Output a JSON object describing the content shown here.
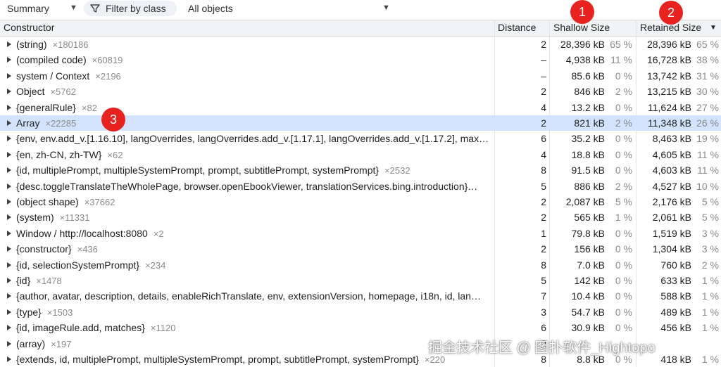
{
  "toolbar": {
    "view_label": "Summary",
    "filter_label": "Filter by class",
    "objects_label": "All objects"
  },
  "columns": {
    "constructor": "Constructor",
    "distance": "Distance",
    "shallow": "Shallow Size",
    "retained": "Retained Size"
  },
  "rows": [
    {
      "name": "(string)",
      "count": "×180186",
      "distance": "2",
      "shallow": "28,396 kB",
      "shallow_pct": "65 %",
      "retained": "28,396 kB",
      "retained_pct": "65 %"
    },
    {
      "name": "(compiled code)",
      "count": "×60819",
      "distance": "–",
      "shallow": "4,938 kB",
      "shallow_pct": "11 %",
      "retained": "16,728 kB",
      "retained_pct": "38 %"
    },
    {
      "name": "system / Context",
      "count": "×2196",
      "distance": "–",
      "shallow": "85.6 kB",
      "shallow_pct": "0 %",
      "retained": "13,742 kB",
      "retained_pct": "31 %"
    },
    {
      "name": "Object",
      "count": "×5762",
      "distance": "2",
      "shallow": "846 kB",
      "shallow_pct": "2 %",
      "retained": "13,215 kB",
      "retained_pct": "30 %"
    },
    {
      "name": "{generalRule}",
      "count": "×82",
      "distance": "4",
      "shallow": "13.2 kB",
      "shallow_pct": "0 %",
      "retained": "11,624 kB",
      "retained_pct": "27 %"
    },
    {
      "name": "Array",
      "count": "×22285",
      "distance": "2",
      "shallow": "821 kB",
      "shallow_pct": "2 %",
      "retained": "11,348 kB",
      "retained_pct": "26 %"
    },
    {
      "name": "{env, env.add_v.[1.16.10], langOverrides, langOverrides.add_v.[1.17.1], langOverrides.add_v.[1.17.2], max…",
      "count": "",
      "distance": "6",
      "shallow": "35.2 kB",
      "shallow_pct": "0 %",
      "retained": "8,463 kB",
      "retained_pct": "19 %"
    },
    {
      "name": "{en, zh-CN, zh-TW}",
      "count": "×62",
      "distance": "4",
      "shallow": "18.8 kB",
      "shallow_pct": "0 %",
      "retained": "4,605 kB",
      "retained_pct": "11 %"
    },
    {
      "name": "{id, multiplePrompt, multipleSystemPrompt, prompt, subtitlePrompt, systemPrompt}",
      "count": "×2532",
      "distance": "8",
      "shallow": "91.5 kB",
      "shallow_pct": "0 %",
      "retained": "4,603 kB",
      "retained_pct": "11 %"
    },
    {
      "name": "{desc.toggleTranslateTheWholePage, browser.openEbookViewer, translationServices.bing.introduction}…",
      "count": "",
      "distance": "5",
      "shallow": "886 kB",
      "shallow_pct": "2 %",
      "retained": "4,527 kB",
      "retained_pct": "10 %"
    },
    {
      "name": "(object shape)",
      "count": "×37662",
      "distance": "2",
      "shallow": "2,087 kB",
      "shallow_pct": "5 %",
      "retained": "2,176 kB",
      "retained_pct": "5 %"
    },
    {
      "name": "(system)",
      "count": "×11331",
      "distance": "2",
      "shallow": "565 kB",
      "shallow_pct": "1 %",
      "retained": "2,061 kB",
      "retained_pct": "5 %"
    },
    {
      "name": "Window / http://localhost:8080",
      "count": "×2",
      "distance": "1",
      "shallow": "79.8 kB",
      "shallow_pct": "0 %",
      "retained": "1,519 kB",
      "retained_pct": "3 %"
    },
    {
      "name": "{constructor}",
      "count": "×436",
      "distance": "2",
      "shallow": "156 kB",
      "shallow_pct": "0 %",
      "retained": "1,304 kB",
      "retained_pct": "3 %"
    },
    {
      "name": "{id, selectionSystemPrompt}",
      "count": "×234",
      "distance": "8",
      "shallow": "7.0 kB",
      "shallow_pct": "0 %",
      "retained": "760 kB",
      "retained_pct": "2 %"
    },
    {
      "name": "{id}",
      "count": "×1478",
      "distance": "5",
      "shallow": "142 kB",
      "shallow_pct": "0 %",
      "retained": "633 kB",
      "retained_pct": "1 %"
    },
    {
      "name": "{author, avatar, description, details, enableRichTranslate, env, extensionVersion, homepage, i18n, id, lan…",
      "count": "",
      "distance": "7",
      "shallow": "10.4 kB",
      "shallow_pct": "0 %",
      "retained": "588 kB",
      "retained_pct": "1 %"
    },
    {
      "name": "{type}",
      "count": "×1503",
      "distance": "3",
      "shallow": "54.7 kB",
      "shallow_pct": "0 %",
      "retained": "489 kB",
      "retained_pct": "1 %"
    },
    {
      "name": "{id, imageRule.add, matches}",
      "count": "×1120",
      "distance": "6",
      "shallow": "30.9 kB",
      "shallow_pct": "0 %",
      "retained": "456 kB",
      "retained_pct": "1 %"
    },
    {
      "name": "(array)",
      "count": "×197",
      "distance": "2",
      "shallow": "",
      "shallow_pct": "",
      "retained": "",
      "retained_pct": ""
    },
    {
      "name": "{extends, id, multiplePrompt, multipleSystemPrompt, prompt, subtitlePrompt, systemPrompt}",
      "count": "×220",
      "distance": "8",
      "shallow": "8.8 kB",
      "shallow_pct": "0 %",
      "retained": "418 kB",
      "retained_pct": "1 %"
    }
  ],
  "selected_row": 5,
  "markers": [
    "1",
    "2",
    "3"
  ],
  "watermark": "掘金技术社区 @ 图扑软件_Hightopo",
  "colors": {
    "selected_row_bg": "#d3e3fd",
    "marker_red": "#e8231f",
    "header_bg": "#f1f3f4"
  }
}
